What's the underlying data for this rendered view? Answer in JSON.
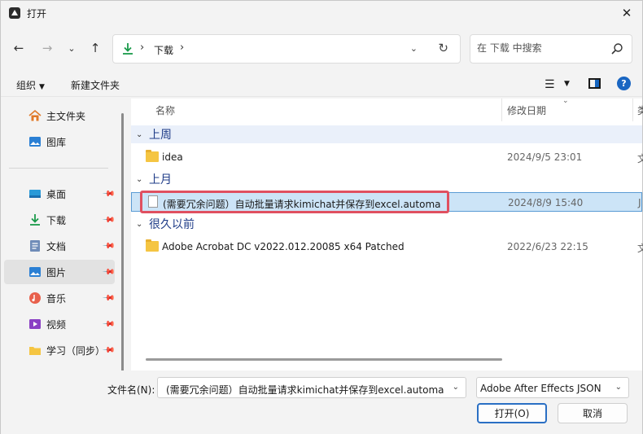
{
  "window": {
    "title": "打开"
  },
  "nav": {
    "address_location": "下载",
    "search_placeholder": "在 下载 中搜索"
  },
  "toolbar": {
    "organize_label": "组织",
    "new_folder_label": "新建文件夹"
  },
  "sidebar": {
    "items": [
      {
        "label": "主文件夹",
        "icon": "home-icon"
      },
      {
        "label": "图库",
        "icon": "gallery-icon"
      },
      {
        "label": "桌面",
        "icon": "desktop-icon",
        "pinned": true
      },
      {
        "label": "下载",
        "icon": "download-icon",
        "pinned": true
      },
      {
        "label": "文档",
        "icon": "document-icon",
        "pinned": true
      },
      {
        "label": "图片",
        "icon": "pictures-icon",
        "pinned": true,
        "selected": true
      },
      {
        "label": "音乐",
        "icon": "music-icon",
        "pinned": true
      },
      {
        "label": "视频",
        "icon": "video-icon",
        "pinned": true
      },
      {
        "label": "学习（同步）",
        "icon": "folder-icon",
        "pinned": true
      }
    ]
  },
  "list": {
    "columns": {
      "name": "名称",
      "modified": "修改日期",
      "type": "类"
    },
    "groups": [
      {
        "title": "上周",
        "rows": [
          {
            "name": "idea",
            "date": "2024/9/5 23:01",
            "type": "文",
            "kind": "folder"
          }
        ]
      },
      {
        "title": "上月",
        "rows": [
          {
            "name": "(需要冗余问题）自动批量请求kimichat并保存到excel.automa",
            "date": "2024/8/9 15:40",
            "type": "J",
            "kind": "file",
            "selected": true
          }
        ]
      },
      {
        "title": "很久以前",
        "rows": [
          {
            "name": "Adobe Acrobat DC v2022.012.20085 x64 Patched",
            "date": "2022/6/23 22:15",
            "type": "文",
            "kind": "folder"
          }
        ]
      }
    ]
  },
  "footer": {
    "filename_label": "文件名(N):",
    "filename_value": "(需要冗余问题）自动批量请求kimichat并保存到excel.automa",
    "filetype_value": "Adobe After Effects JSON",
    "open_label": "打开(O)",
    "cancel_label": "取消"
  },
  "colors": {
    "accent": "#1a66c2",
    "selection": "#cce4f7",
    "highlight": "#e05060",
    "group_title": "#1f3c88"
  }
}
